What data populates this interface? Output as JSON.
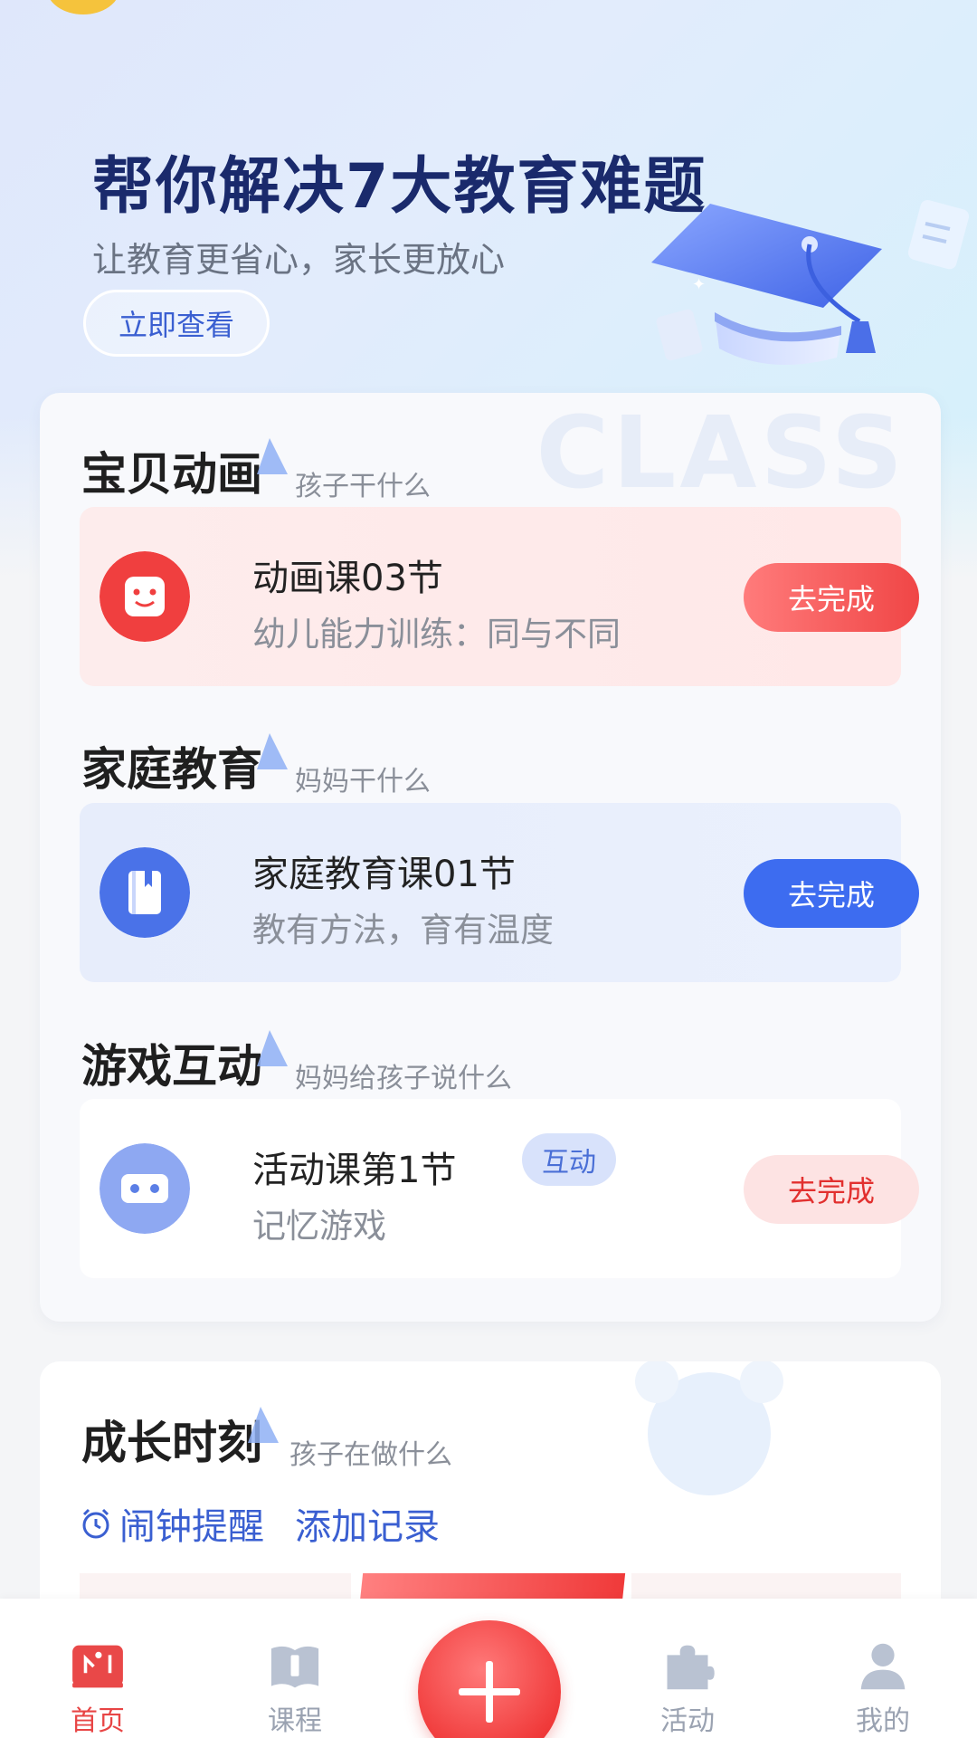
{
  "banner": {
    "title": "帮你解决7大教育难题",
    "subtitle": "让教育更省心，家长更放心",
    "button": "立即查看"
  },
  "watermark": "CLASS",
  "sections": [
    {
      "title": "宝贝动画",
      "subtitle": "孩子干什么",
      "task": {
        "title": "动画课03节",
        "desc": "幼儿能力训练：同与不同",
        "button": "去完成",
        "icon": "smiley-icon"
      }
    },
    {
      "title": "家庭教育",
      "subtitle": "妈妈干什么",
      "task": {
        "title": "家庭教育课01节",
        "desc": "教有方法，育有温度",
        "button": "去完成",
        "icon": "book-icon"
      }
    },
    {
      "title": "游戏互动",
      "subtitle": "妈妈给孩子说什么",
      "task": {
        "title": "活动课第1节",
        "tag": "互动",
        "desc": "记忆游戏",
        "button": "去完成",
        "icon": "vr-glasses-icon"
      }
    }
  ],
  "growth": {
    "title": "成长时刻",
    "subtitle": "孩子在做什么",
    "alarm_label": "闹钟提醒",
    "add_label": "添加记录"
  },
  "tabbar": {
    "items": [
      {
        "label": "首页",
        "icon": "home-icon",
        "active": true
      },
      {
        "label": "课程",
        "icon": "book-open-icon",
        "active": false
      },
      {
        "label": "活动",
        "icon": "puzzle-icon",
        "active": false
      },
      {
        "label": "我的",
        "icon": "user-icon",
        "active": false
      }
    ],
    "fab_icon": "plus-icon"
  },
  "colors": {
    "accent_red": "#f04646",
    "accent_blue": "#3d6cf0",
    "banner_title": "#1a2a6c"
  }
}
